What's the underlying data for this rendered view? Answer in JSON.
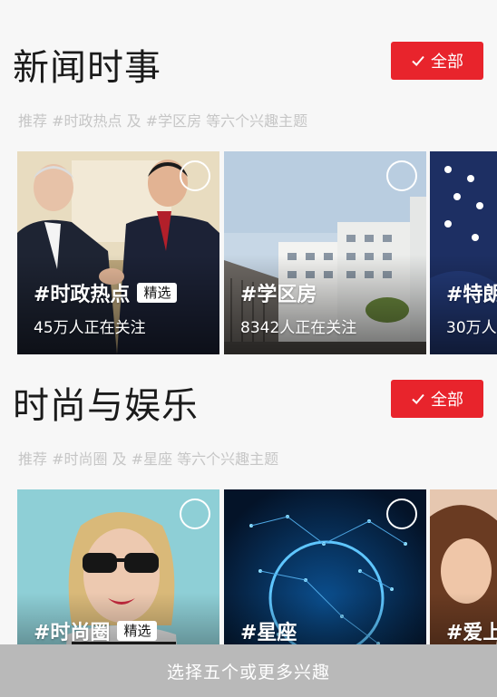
{
  "sections": [
    {
      "title": "新闻时事",
      "all_label": "全部",
      "subtitle": "推荐 #时政热点 及 #学区房 等六个兴趣主题",
      "cards": [
        {
          "tag": "#时政热点",
          "badge": "精选",
          "followers": "45万人正在关注",
          "image": "handshake-photo"
        },
        {
          "tag": "#学区房",
          "badge": "",
          "followers": "8342人正在关注",
          "image": "apartment-building-photo"
        },
        {
          "tag": "#特朗",
          "badge": "",
          "followers": "30万人",
          "image": "flag-portrait-photo"
        }
      ]
    },
    {
      "title": "时尚与娱乐",
      "all_label": "全部",
      "subtitle": "推荐 #时尚圈 及 #星座 等六个兴趣主题",
      "cards": [
        {
          "tag": "#时尚圈",
          "badge": "精选",
          "followers": "",
          "image": "sunglasses-woman-photo"
        },
        {
          "tag": "#星座",
          "badge": "",
          "followers": "",
          "image": "constellation-photo"
        },
        {
          "tag": "#爱上",
          "badge": "",
          "followers": "",
          "image": "hair-model-photo"
        }
      ]
    }
  ],
  "bottom_button": "选择五个或更多兴趣",
  "colors": {
    "accent": "#e8242c",
    "background": "#f7f7f7",
    "bottom_bar": "#b9b9b9",
    "subtitle": "#c6c6c6"
  }
}
